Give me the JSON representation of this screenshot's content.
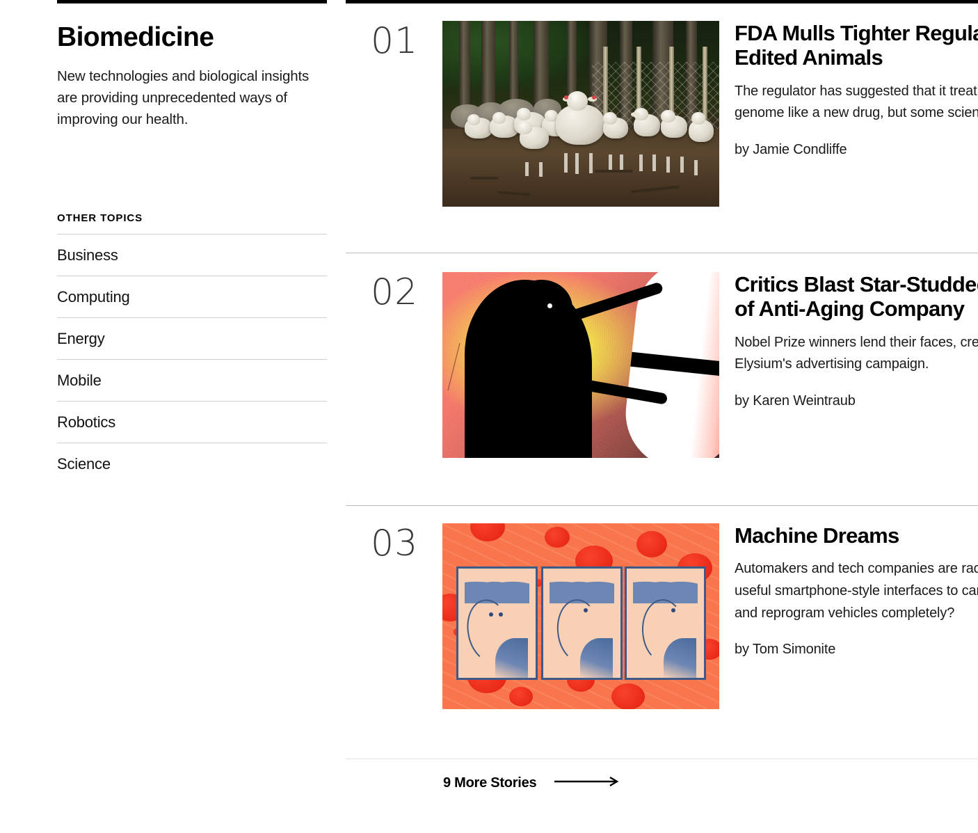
{
  "section": {
    "title": "Biomedicine",
    "description": "New technologies and biological insights are providing unprecedented ways of improving our health."
  },
  "sidebar": {
    "other_topics_label": "OTHER TOPICS",
    "topics": [
      {
        "label": "Business"
      },
      {
        "label": "Computing"
      },
      {
        "label": "Energy"
      },
      {
        "label": "Mobile"
      },
      {
        "label": "Robotics"
      },
      {
        "label": "Science"
      }
    ]
  },
  "stories": [
    {
      "number": "01",
      "headline_line1": "FDA Mulls Tighter Regulation of Gene-",
      "headline_line2": "Edited Animals",
      "dek_line1": "The regulator has suggested that it treat changes to an animal's",
      "dek_line2": "genome like a new drug, but some scientists disagree.",
      "byline": "by Jamie Condliffe",
      "image": "sheep-lambs-forest-fence-photo"
    },
    {
      "number": "02",
      "headline_line1": "Critics Blast Star-Studded Endorsement",
      "headline_line2": "of Anti-Aging Company",
      "dek_line1": "Nobel Prize winners lend their faces, credibility, and names to",
      "dek_line2": "Elysium's advertising campaign.",
      "byline": "by Karen Weintraub",
      "image": "silhouette-opening-pill-illustration"
    },
    {
      "number": "03",
      "headline_line1": "Machine Dreams",
      "headline_line2": "",
      "dek_line1": "Automakers and tech companies are racing to build more",
      "dek_line2": "useful smartphone-style interfaces to cars. Will software remake",
      "dek_line3": "and reprogram vehicles completely?",
      "byline": "by Tom Simonite",
      "image": "three-faces-blood-cells-illustration"
    }
  ],
  "more": {
    "label": "9 More Stories",
    "arrow_icon": "arrow-right-icon"
  },
  "colors": {
    "rule": "#000000",
    "divider": "#b9b9b9",
    "text": "#111111",
    "number": "#3a3a3a"
  }
}
